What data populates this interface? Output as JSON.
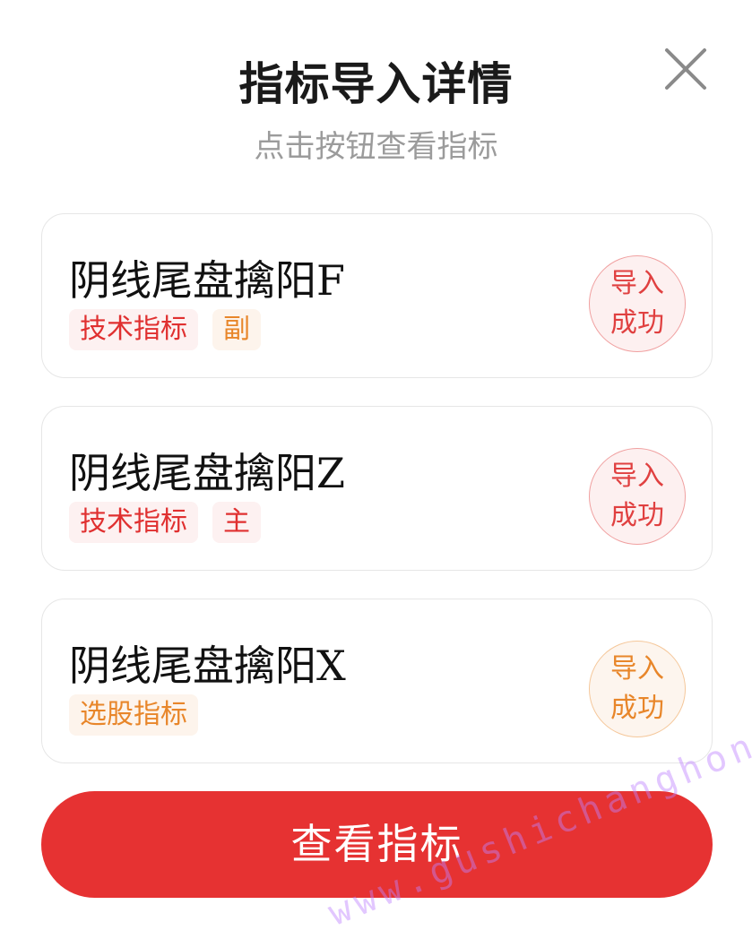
{
  "dialog": {
    "title": "指标导入详情",
    "subtitle": "点击按钮查看指标",
    "close_icon": "close-icon"
  },
  "cards": [
    {
      "name": "阴线尾盘擒阳F",
      "tags": [
        {
          "label": "技术指标",
          "color": "#e03030"
        },
        {
          "label": "副",
          "color": "#e8862a"
        }
      ],
      "status": {
        "line1": "导入",
        "line2": "成功",
        "color": "#e04040"
      }
    },
    {
      "name": "阴线尾盘擒阳Z",
      "tags": [
        {
          "label": "技术指标",
          "color": "#e03030"
        },
        {
          "label": "主",
          "color": "#e03030"
        }
      ],
      "status": {
        "line1": "导入",
        "line2": "成功",
        "color": "#e04040"
      }
    },
    {
      "name": "阴线尾盘擒阳X",
      "tags": [
        {
          "label": "选股指标",
          "color": "#e8862a"
        }
      ],
      "status": {
        "line1": "导入",
        "line2": "成功",
        "color": "#e8862a"
      }
    }
  ],
  "primary_button": {
    "label": "查看指标",
    "color": "#e63232"
  },
  "watermark": "www.gushichanghong.com"
}
